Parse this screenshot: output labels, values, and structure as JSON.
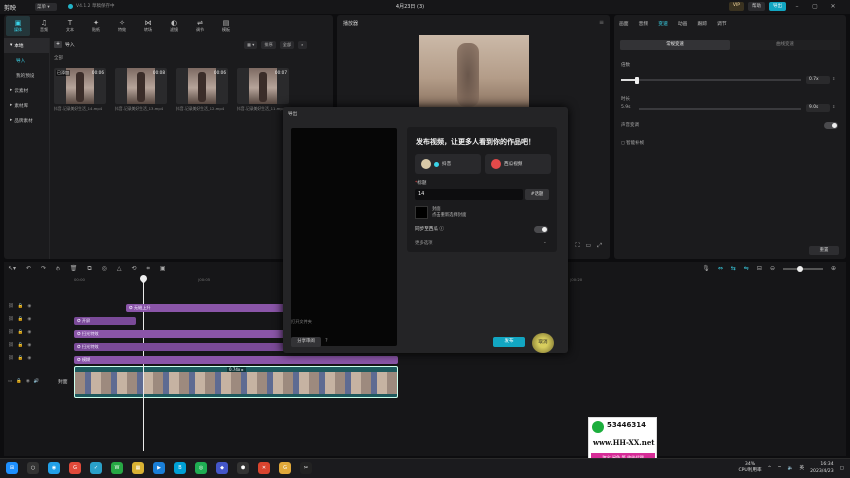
{
  "app": {
    "logo": "剪映",
    "menu": "菜单 ▾",
    "version_status": "V4.1.2 草稿保存中",
    "title": "4月23日 (3)"
  },
  "top_right": {
    "vip": "VIP",
    "share": "帮助",
    "publish": "导出"
  },
  "tool_tabs": [
    {
      "label": "媒体",
      "icon": "▣"
    },
    {
      "label": "音频",
      "icon": "♫"
    },
    {
      "label": "文本",
      "icon": "T"
    },
    {
      "label": "贴纸",
      "icon": "✦"
    },
    {
      "label": "特效",
      "icon": "✧"
    },
    {
      "label": "转场",
      "icon": "⋈"
    },
    {
      "label": "滤镜",
      "icon": "◐"
    },
    {
      "label": "调节",
      "icon": "⇌"
    },
    {
      "label": "模板",
      "icon": "▤"
    }
  ],
  "media_side": [
    {
      "label": "本地",
      "state": "active"
    },
    {
      "label": "导入",
      "state": "sel"
    },
    {
      "label": "我的预设",
      "state": ""
    },
    {
      "label": "云素材",
      "state": ""
    },
    {
      "label": "素材库",
      "state": ""
    },
    {
      "label": "品牌素材",
      "state": ""
    }
  ],
  "media": {
    "import": "导入",
    "sort": "排序",
    "all_filter": "全部",
    "all_label": "全部",
    "thumbs": [
      {
        "duration": "00:06",
        "badge": "已添加",
        "caption": "抖音-记录美好生活_14.mp4"
      },
      {
        "duration": "00:08",
        "badge": "",
        "caption": "抖音-记录美好生活_13.mp4"
      },
      {
        "duration": "00:06",
        "badge": "",
        "caption": "抖音-记录美好生活_12.mp4"
      },
      {
        "duration": "00:07",
        "badge": "",
        "caption": "抖音-记录美好生活_11.mp4"
      }
    ]
  },
  "player": {
    "title": "播放器"
  },
  "prop": {
    "tabs": [
      "画面",
      "音频",
      "变速",
      "动画",
      "跟踪",
      "调节"
    ],
    "active_tab": "变速",
    "sub_tabs": [
      "常规变速",
      "曲线变速"
    ],
    "speed_label": "倍数",
    "speed_value": "0.7x",
    "speed_fraction": 0.09,
    "duration_label": "时长",
    "duration_left": "5.9s",
    "duration_value": "9.0s",
    "pitch_label": "声音变调",
    "smooth_label": "智能补帧",
    "reset": "重置"
  },
  "timeline": {
    "ruler": [
      "00:00",
      "|00:05",
      "|00:10",
      "|00:15",
      "|00:20"
    ],
    "clips": [
      {
        "label": "无缝上升",
        "track": 0
      },
      {
        "label": "开屏",
        "track": 1
      },
      {
        "label": "扫光特效",
        "track": 2
      },
      {
        "label": "扫光特效",
        "track": 3
      },
      {
        "label": "模糊",
        "track": 4
      }
    ],
    "main_clip_tag": "0.74x ▸",
    "cover": "封面"
  },
  "export": {
    "title": "导出",
    "preview_hint": "打开文件夹",
    "heading": "发布视频，让更多人看到你的作品吧！",
    "platforms": [
      "抖音",
      "西瓜视频"
    ],
    "title_label": "标题",
    "title_required": "*",
    "title_value": "14",
    "topic_button": "#话题",
    "cover_label": "封面",
    "cover_hint": "点击重新选择封面",
    "sync_label": "同步至西瓜 ⓘ",
    "more_options": "更多选项",
    "share_button": "分享审阅",
    "publish_button": "发布",
    "cancel_button": "取消"
  },
  "watermark": {
    "qq": "53446314",
    "site": "www.HH-XX.net",
    "sub": "淘宝 闲鱼 等 收徒代理"
  },
  "taskbar": {
    "apps": [
      {
        "icon": "⊞",
        "color": "#1e90ff"
      },
      {
        "icon": "○",
        "color": "#333"
      },
      {
        "icon": "◉",
        "color": "#22a0e8"
      },
      {
        "icon": "G",
        "color": "#e04a3a"
      },
      {
        "icon": "✓",
        "color": "#2aa0c8"
      },
      {
        "icon": "W",
        "color": "#27a844"
      },
      {
        "icon": "▦",
        "color": "#d9b233"
      },
      {
        "icon": "▶",
        "color": "#1a7fd8"
      },
      {
        "icon": "B",
        "color": "#00a1d6"
      },
      {
        "icon": "◎",
        "color": "#1fae53"
      },
      {
        "icon": "◆",
        "color": "#4456c8"
      },
      {
        "icon": "⬢",
        "color": "#333"
      },
      {
        "icon": "✕",
        "color": "#d9442e"
      },
      {
        "icon": "G",
        "color": "#e0a83a"
      },
      {
        "icon": "✂",
        "color": "#222"
      }
    ],
    "cpu_pct": "34%",
    "cpu_label": "CPU利用率",
    "time": "16:34",
    "date": "2023/4/23",
    "lang": "英"
  }
}
